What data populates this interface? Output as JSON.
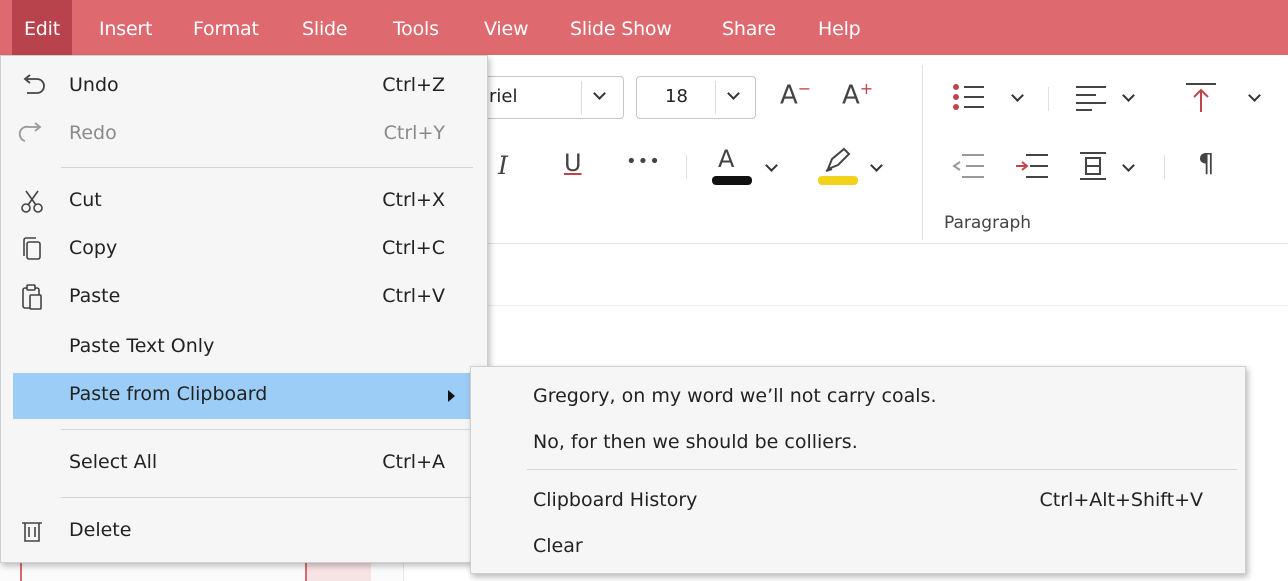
{
  "menubar": {
    "items": [
      "Edit",
      "Insert",
      "Format",
      "Slide",
      "Tools",
      "View",
      "Slide Show",
      "Share",
      "Help"
    ]
  },
  "ribbon": {
    "font_name": "riel",
    "font_size": "18",
    "paragraph_label": "Paragraph",
    "font_color": "#111111",
    "highlight_color": "#f2d21b",
    "accent": "#de6a70"
  },
  "edit_menu": {
    "undo": {
      "label": "Undo",
      "shortcut": "Ctrl+Z"
    },
    "redo": {
      "label": "Redo",
      "shortcut": "Ctrl+Y"
    },
    "cut": {
      "label": "Cut",
      "shortcut": "Ctrl+X"
    },
    "copy": {
      "label": "Copy",
      "shortcut": "Ctrl+C"
    },
    "paste": {
      "label": "Paste",
      "shortcut": "Ctrl+V"
    },
    "paste_text_only": {
      "label": "Paste Text Only"
    },
    "paste_from_clipboard": {
      "label": "Paste from Clipboard"
    },
    "select_all": {
      "label": "Select All",
      "shortcut": "Ctrl+A"
    },
    "delete": {
      "label": "Delete"
    }
  },
  "clipboard_submenu": {
    "entries": [
      "Gregory, on my word we’ll not carry coals.",
      "No, for then we should be colliers."
    ],
    "history": {
      "label": "Clipboard History",
      "shortcut": "Ctrl+Alt+Shift+V"
    },
    "clear": {
      "label": "Clear"
    }
  }
}
